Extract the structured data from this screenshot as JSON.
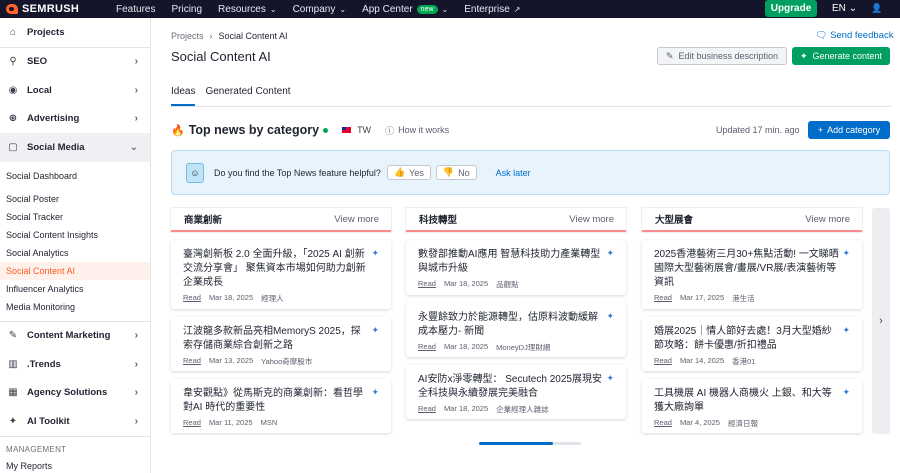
{
  "topbar": {
    "logo": "SEMRUSH",
    "nav": [
      {
        "label": "Features",
        "chevron": false
      },
      {
        "label": "Pricing",
        "chevron": false
      },
      {
        "label": "Resources",
        "chevron": true
      },
      {
        "label": "Company",
        "chevron": true
      },
      {
        "label": "App Center",
        "badge": "new",
        "chevron": true
      },
      {
        "label": "Enterprise",
        "external": true
      }
    ],
    "upgrade": "Upgrade",
    "lang": "EN",
    "accent": "#14142b",
    "upgrade_color": "#009f60"
  },
  "sidebar": {
    "groups": [
      {
        "label": "Projects",
        "icon": "home-icon"
      },
      {
        "label": "SEO",
        "icon": "seo-icon"
      },
      {
        "label": "Local",
        "icon": "location-pin-icon"
      },
      {
        "label": "Advertising",
        "icon": "target-icon"
      },
      {
        "label": "Social Media",
        "icon": "social-icon"
      }
    ],
    "social_items": [
      "Social Dashboard",
      "Social Poster",
      "Social Tracker",
      "Social Content Insights",
      "Social Analytics",
      "Social Content AI",
      "Influencer Analytics",
      "Media Monitoring"
    ],
    "groups_after": [
      {
        "label": "Content Marketing",
        "icon": "content-icon"
      },
      {
        "label": ".Trends",
        "icon": "trends-icon"
      },
      {
        "label": "Agency Solutions",
        "icon": "agency-icon"
      },
      {
        "label": "AI Toolkit",
        "icon": "ai-icon"
      }
    ],
    "management": "MANAGEMENT",
    "my_reports": "My Reports"
  },
  "main": {
    "breadcrumb": [
      "Projects",
      "Social Content AI"
    ],
    "send_feedback": "Send feedback",
    "title": "Social Content AI",
    "edit_business": "Edit business description",
    "generate": "Generate content",
    "tabs": [
      "Ideas",
      "Generated Content"
    ],
    "top_news": {
      "title": "Top news by category",
      "country": "TW",
      "how": "How it works",
      "updated": "Updated 17 min. ago",
      "add_category": "Add category"
    },
    "feedback": {
      "question": "Do you find the Top News feature helpful?",
      "yes": "Yes",
      "no": "No",
      "later": "Ask later"
    },
    "view_more": "View more",
    "read": "Read",
    "columns": [
      {
        "title": "商業創新",
        "cards": [
          {
            "title": "臺灣創新板 2.0 全面升級，「2025 AI 創新交流分享會」 聚焦資本市場如何助力創新企業成長",
            "date": "Mar 18, 2025",
            "source": "經理人"
          },
          {
            "title": "江波龍多款新品亮相MemoryS 2025，探索存儲商業綜合創新之路",
            "date": "Mar 13, 2025",
            "source": "Yahoo奇摩股市"
          },
          {
            "title": "韋安觀點》從馬斯克的商業創新：看哲學對AI 時代的重要性",
            "date": "Mar 11, 2025",
            "source": "MSN"
          }
        ]
      },
      {
        "title": "科技轉型",
        "cards": [
          {
            "title": "數發部推動AI應用 智慧科技助力產業轉型與城市升級",
            "date": "Mar 18, 2025",
            "source": "品觀點"
          },
          {
            "title": "永豐餘致力於能源轉型，估原料波動緩解成本壓力- 新聞",
            "date": "Mar 18, 2025",
            "source": "MoneyDJ理財網"
          },
          {
            "title": "AI安防x淨零轉型： Secutech 2025展現安全科技與永續發展完美融合",
            "date": "Mar 18, 2025",
            "source": "企業經理人雜誌"
          }
        ]
      },
      {
        "title": "大型展會",
        "cards": [
          {
            "title": "2025香港藝術三月30+焦點活動! 一文睇晒國際大型藝術展會/畫展/VR展/表演藝術等資訊",
            "date": "Mar 17, 2025",
            "source": "港生活"
          },
          {
            "title": "婚展2025｜情人節好去處！3月大型婚紗節攻略：餅卡優惠/折扣禮品",
            "date": "Mar 14, 2025",
            "source": "香港01"
          },
          {
            "title": "工具機展 AI 機器人商機火 上銀、和大等獲大廠詢單",
            "date": "Mar 4, 2025",
            "source": "經濟日報"
          }
        ]
      }
    ],
    "pager_progress": 0.73
  }
}
